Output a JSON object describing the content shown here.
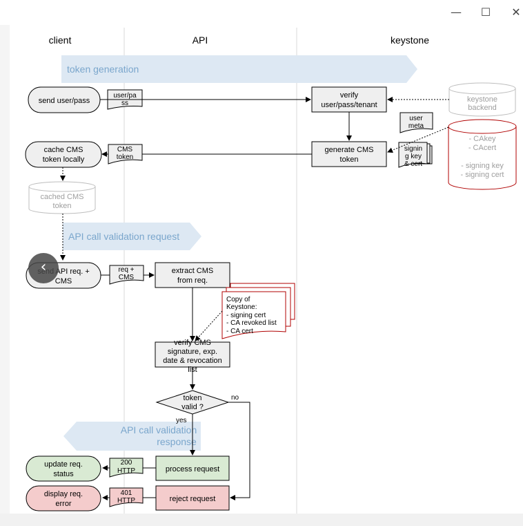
{
  "window": {
    "minimize_icon": "minimize-icon",
    "maximize_icon": "maximize-icon",
    "close_icon": "close-icon",
    "minimize_glyph": "—",
    "maximize_glyph": "☐",
    "close_glyph": "✕"
  },
  "lanes": {
    "client": "client",
    "api": "API",
    "keystone": "keystone"
  },
  "banners": {
    "token_generation": "token generation",
    "validation_request": "API call validation request",
    "validation_response_line1": "API call validation",
    "validation_response_line2": "response"
  },
  "nodes": {
    "send_userpass": "send user/pass",
    "userpass_doc_l1": "user/pa",
    "userpass_doc_l2": "ss",
    "verify_l1": "verify",
    "verify_l2": "user/pass/tenant",
    "ks_backend_l1": "keystone",
    "ks_backend_l2": "backend",
    "user_meta_l1": "user",
    "user_meta_l2": "meta",
    "cakey_l1": "- CAkey",
    "cakey_l2": "- CAcert",
    "cakey_l3": "- signing key",
    "cakey_l4": "- signing cert",
    "signing_l1": "signin",
    "signing_l2": "g key",
    "signing_l3": "& cert",
    "generate_l1": "generate CMS",
    "generate_l2": "token",
    "cms_token_l1": "CMS",
    "cms_token_l2": "token",
    "cache_l1": "cache CMS",
    "cache_l2": "token locally",
    "cached_l1": "cached CMS",
    "cached_l2": "token",
    "send_api_l1": "send API req. +",
    "send_api_l2": "CMS",
    "req_cms_l1": "req +",
    "req_cms_l2": "CMS",
    "extract_l1": "extract CMS",
    "extract_l2": "from req.",
    "copy_l1": "Copy of",
    "copy_l2": "Keystone:",
    "copy_l3": "- signing cert",
    "copy_l4": "- CA revoked list",
    "copy_l5": "- CA cert",
    "verify_cms_l1": "verify CMS",
    "verify_cms_l2": "signature, exp.",
    "verify_cms_l3": "date & revocation",
    "verify_cms_l4": "list",
    "token_valid_l1": "token",
    "token_valid_l2": "valid ?",
    "no": "no",
    "yes": "yes",
    "process": "process request",
    "reject": "reject request",
    "ok_doc_l1": "200",
    "ok_doc_l2": "HTTP",
    "err_doc_l1": "401",
    "err_doc_l2": "HTTP",
    "update_l1": "update req.",
    "update_l2": "status",
    "display_l1": "display req.",
    "display_l2": "error"
  },
  "colors": {
    "banner": "#dde8f3",
    "banner_text": "#7aa6cc",
    "process_fill": "#efefef",
    "green": "#d9ead3",
    "red": "#f4cccc",
    "dark_red": "#b00000",
    "lane_line": "#d9d9d9"
  },
  "back_button": {
    "glyph": "‹"
  }
}
